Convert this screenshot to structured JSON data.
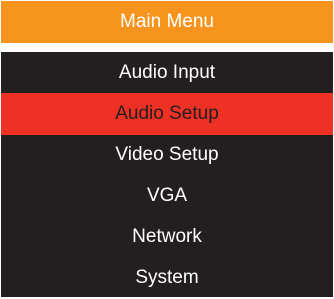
{
  "menu": {
    "title": "Main Menu",
    "selected_index": 1,
    "items": [
      {
        "label": "Audio Input"
      },
      {
        "label": "Audio Setup"
      },
      {
        "label": "Video Setup"
      },
      {
        "label": "VGA"
      },
      {
        "label": "Network"
      },
      {
        "label": "System"
      }
    ]
  },
  "colors": {
    "header_bg": "#f7941d",
    "list_bg": "#231f20",
    "selected_bg": "#ee3124",
    "text": "#ffffff",
    "selected_text": "#231f20"
  }
}
